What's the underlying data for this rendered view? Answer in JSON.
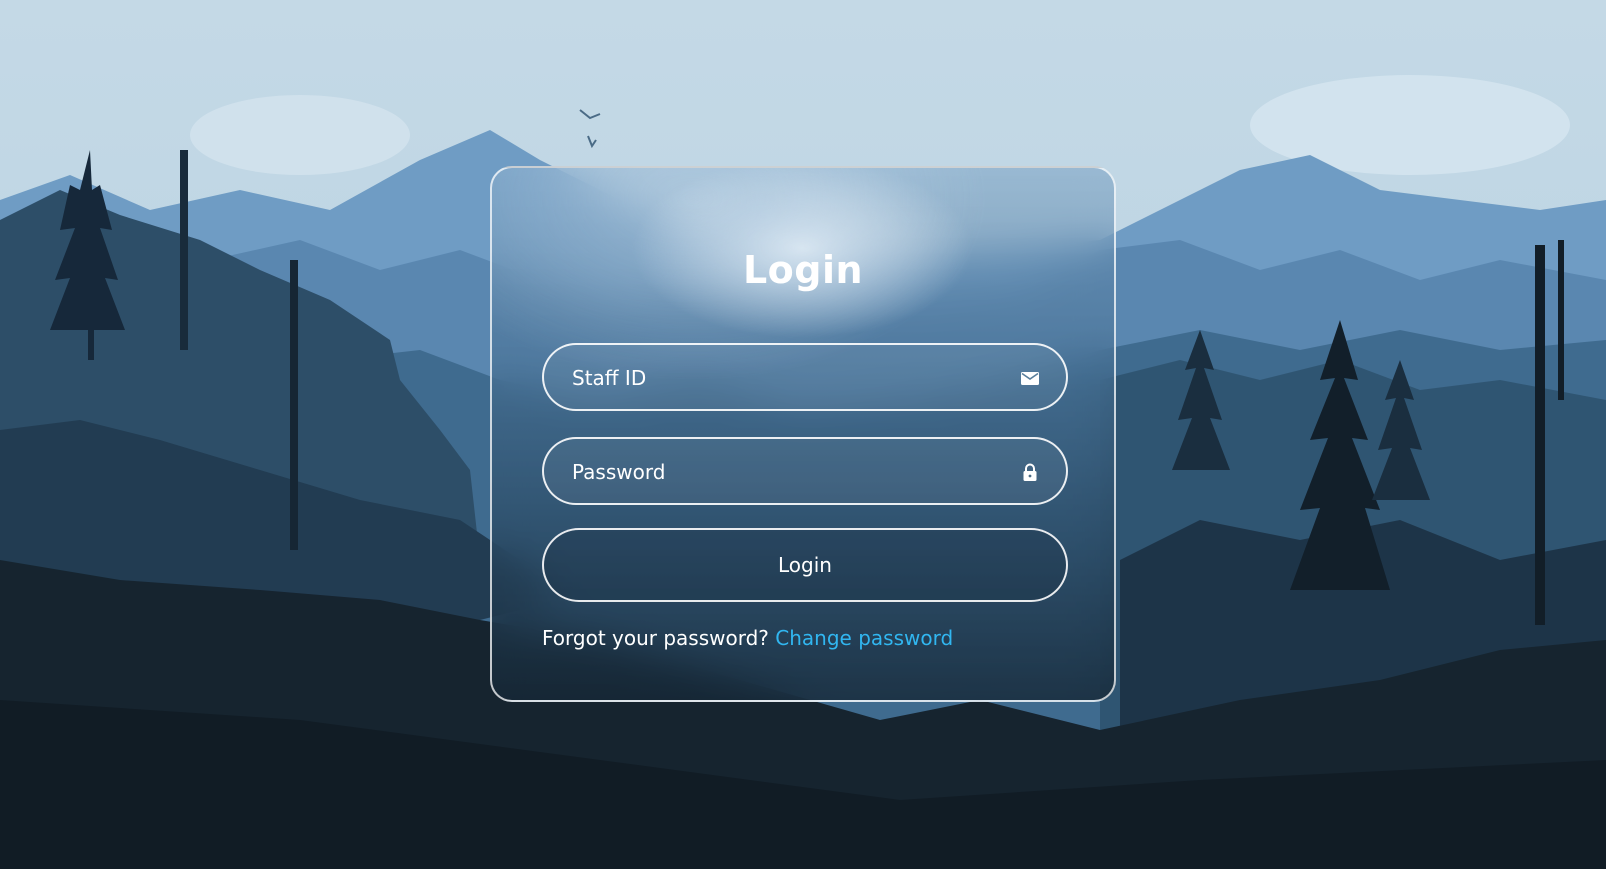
{
  "login": {
    "title": "Login",
    "staff_id": {
      "placeholder": "Staff ID",
      "value": "",
      "icon": "envelope-icon"
    },
    "password": {
      "placeholder": "Password",
      "value": "",
      "icon": "lock-icon"
    },
    "submit_label": "Login",
    "forgot_text": "Forgot your password?",
    "change_password_link": "Change password"
  },
  "colors": {
    "link": "#31b6f0",
    "text": "#ffffff",
    "sky": "#c2d7e4",
    "ground": "#111c25"
  }
}
